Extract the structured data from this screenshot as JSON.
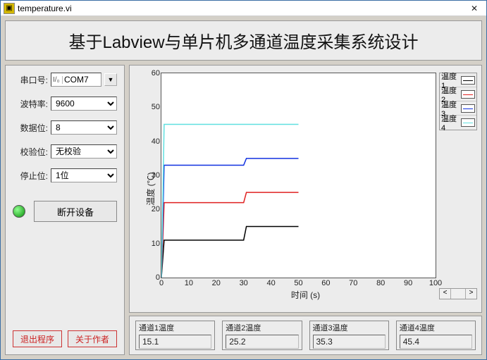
{
  "window": {
    "title": "temperature.vi"
  },
  "header": {
    "title": "基于Labview与单片机多通道温度采集系统设计"
  },
  "serial": {
    "port_label": "串口号:",
    "port_value": "COM7",
    "baud_label": "波特率:",
    "baud_value": "9600",
    "data_label": "数据位:",
    "data_value": "8",
    "parity_label": "校验位:",
    "parity_value": "无校验",
    "stop_label": "停止位:",
    "stop_value": "1位"
  },
  "actions": {
    "disconnect": "断开设备",
    "exit": "退出程序",
    "about": "关于作者"
  },
  "chart_data": {
    "type": "line",
    "title": "",
    "xlabel": "时间 (s)",
    "ylabel": "温度 (℃)",
    "xlim": [
      0,
      100
    ],
    "ylim": [
      0,
      60
    ],
    "xticks": [
      0,
      10,
      20,
      30,
      40,
      50,
      60,
      70,
      80,
      90,
      100
    ],
    "yticks": [
      0,
      10,
      20,
      30,
      40,
      50,
      60
    ],
    "series": [
      {
        "name": "温度1",
        "color": "#000000",
        "x": [
          0,
          1,
          2,
          30,
          31,
          50
        ],
        "y": [
          0,
          11,
          11,
          11,
          15,
          15
        ]
      },
      {
        "name": "温度2",
        "color": "#e02020",
        "x": [
          0,
          1,
          2,
          30,
          31,
          50
        ],
        "y": [
          0,
          22,
          22,
          22,
          25,
          25
        ]
      },
      {
        "name": "温度3",
        "color": "#1030e0",
        "x": [
          0,
          1,
          2,
          30,
          31,
          50
        ],
        "y": [
          0,
          33,
          33,
          33,
          35,
          35
        ]
      },
      {
        "name": "温度4",
        "color": "#60e0e0",
        "x": [
          0,
          1,
          2,
          50
        ],
        "y": [
          0,
          45,
          45,
          45
        ]
      }
    ]
  },
  "readouts": [
    {
      "label": "通道1温度",
      "value": "15.1"
    },
    {
      "label": "通道2温度",
      "value": "25.2"
    },
    {
      "label": "通道3温度",
      "value": "35.3"
    },
    {
      "label": "通道4温度",
      "value": "45.4"
    }
  ]
}
